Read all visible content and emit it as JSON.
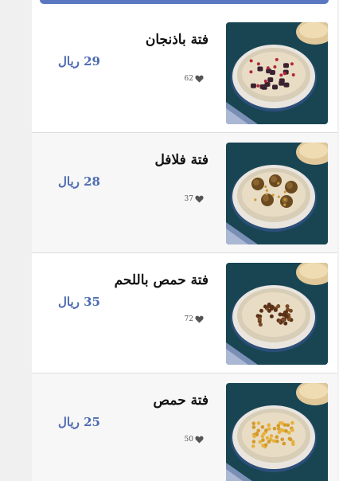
{
  "items": [
    {
      "name": "فتة باذنجان",
      "price": "29 ريال",
      "likes": "62",
      "image": "fatteh-eggplant-photo",
      "topping": "eggplant"
    },
    {
      "name": "فتة فلافل",
      "price": "28 ريال",
      "likes": "37",
      "image": "fatteh-falafel-photo",
      "topping": "falafel"
    },
    {
      "name": "فتة حمص باللحم",
      "price": "35 ريال",
      "likes": "72",
      "image": "fatteh-hummus-meat-photo",
      "topping": "meat"
    },
    {
      "name": "فتة حمص",
      "price": "25 ريال",
      "likes": "50",
      "image": "fatteh-hummus-photo",
      "topping": "chickpeas"
    }
  ],
  "colors": {
    "accent": "#5a78c2",
    "price": "#4c6bb2",
    "background": "#f0f0f0"
  }
}
